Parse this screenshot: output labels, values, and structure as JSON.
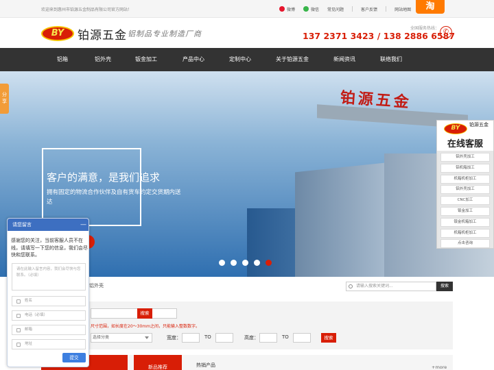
{
  "topbar": {
    "welcome": "欢迎来到惠州市铂源五金制品有限公司官方网站！",
    "weibo": "微博",
    "wechat": "微信",
    "faq": "常见问题",
    "feedback": "客户反馈",
    "sitemap": "网站地图",
    "taobao": "淘"
  },
  "header": {
    "logo_text": "BY",
    "company_name": "铂源五金",
    "slogan": "铝制品专业制造厂商",
    "hotline_label": "全国服务热线：",
    "hotline_numbers": "137 2371 3423 / 138 2886 6587"
  },
  "nav": {
    "items": [
      "铝箱",
      "铝外壳",
      "钣金加工",
      "产品中心",
      "定制中心",
      "关于铂源五金",
      "新闻资讯",
      "联络我们"
    ]
  },
  "banner": {
    "sign_text": "铂源五金",
    "title": "客户的满意，是我们追求",
    "text": "拥有固定的物流合作伙伴及自有货车约定交货期内送达",
    "slide_count": 5,
    "active_slide": 5
  },
  "share_tab": "分享",
  "service": {
    "logo_text": "BY",
    "brand": "铂源五金",
    "title": "在线客服",
    "items": [
      "铝外壳加工",
      "铝机箱加工",
      "机箱机柜加工",
      "铝外壳加工",
      "CNC加工",
      "钣金加工",
      "钣金机箱加工",
      "机箱机柜加工",
      "点击咨询"
    ]
  },
  "breadcrumb": "铝外壳",
  "search": {
    "placeholder": "请输入搜索关键词...",
    "button": "搜索"
  },
  "filter": {
    "search_button": "搜索",
    "note": "尺寸范围，如长度在20～30mm之间，只能输入整数数字。",
    "select_value": "选择分类",
    "width_label": "宽度：",
    "to_label_1": "TO",
    "height_label": "高度：",
    "to_label_2": "TO",
    "filter_button": "搜索"
  },
  "tabs": {
    "new_products": "新品推荐",
    "hot_products": "热销产品",
    "more": "+more"
  },
  "chat": {
    "title": "请您留言",
    "minimize": "—",
    "message": "感谢您的关注，当前客服人员不在线，请填写一下您的信息，我们会尽快和您联系。",
    "textarea_placeholder": "请在此输入留言内容，我们会尽快与您联系。（必填）",
    "name_placeholder": "姓名",
    "phone_placeholder": "电话（必填）",
    "email_placeholder": "邮箱",
    "address_placeholder": "地址",
    "submit": "提交"
  },
  "colors": {
    "accent_red": "#d81e06",
    "nav_dark": "#333333",
    "chat_blue": "#3d6fc1",
    "taobao_orange": "#ff7a00"
  }
}
